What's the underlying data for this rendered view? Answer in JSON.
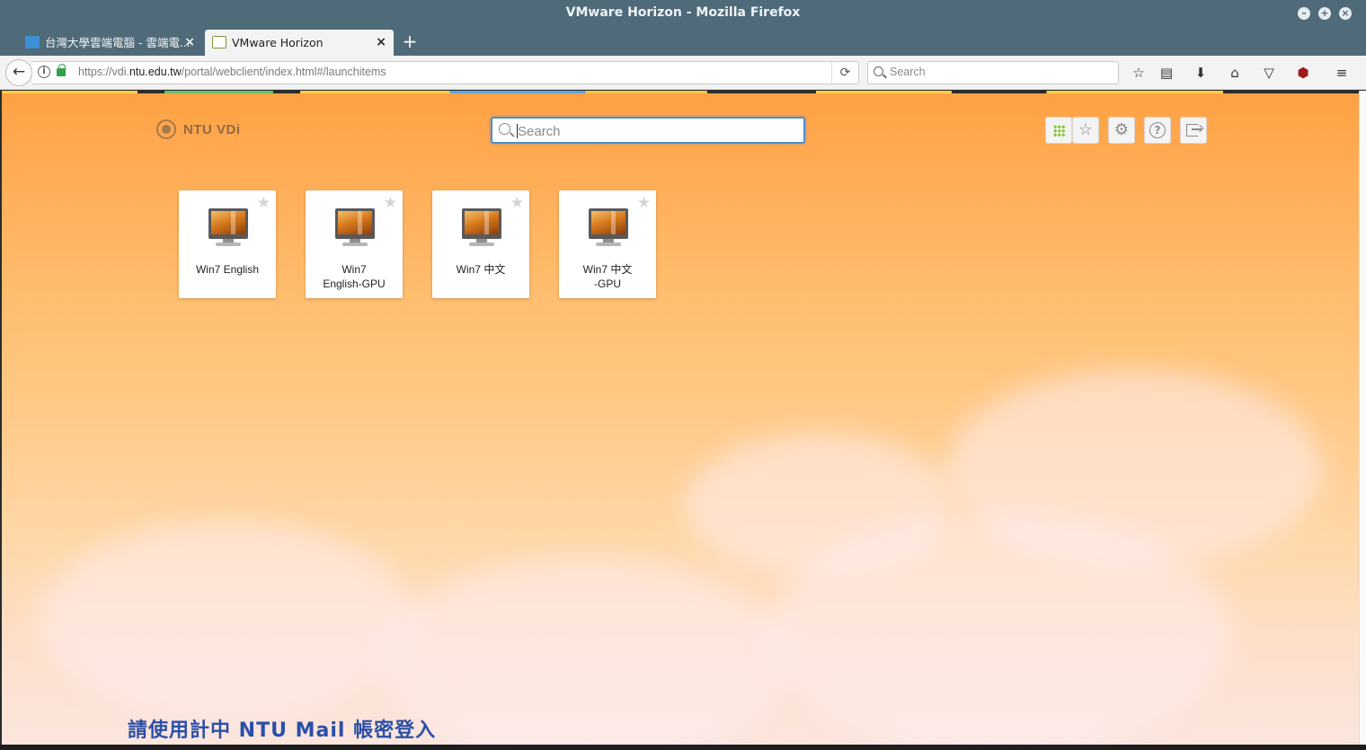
{
  "window": {
    "title": "VMware Horizon - Mozilla Firefox",
    "controls": [
      "minimize",
      "maximize",
      "close"
    ]
  },
  "tabs": [
    {
      "label": "台灣大學雲端電腦 - 雲端電...",
      "active": false,
      "favicon": "cloud-icon"
    },
    {
      "label": "VMware Horizon",
      "active": true,
      "favicon": "horizon-icon"
    }
  ],
  "navbar": {
    "url_prefix": "https://vdi.",
    "url_host": "ntu.edu.tw",
    "url_path": "/portal/webclient/index.html#/launchitems",
    "search_placeholder": "Search",
    "toolbar_icons": [
      "bookmark-star-icon",
      "reading-list-icon",
      "downloads-icon",
      "home-icon",
      "pocket-icon",
      "ublock-icon",
      "menu-icon"
    ]
  },
  "portal": {
    "logo_text": "NTU VDi",
    "search_placeholder": "Search",
    "toolbar_buttons": [
      "all-apps-grid-icon",
      "favorites-star-icon",
      "settings-gear-icon",
      "help-icon",
      "logout-icon"
    ],
    "items": [
      {
        "name": "Win7 English",
        "favorite": false
      },
      {
        "name": "Win7\nEnglish-GPU",
        "favorite": false
      },
      {
        "name": "Win7 中文",
        "favorite": false
      },
      {
        "name": "Win7 中文\n-GPU",
        "favorite": false
      }
    ],
    "login_message": "請使用計中 NTU Mail 帳密登入"
  },
  "colors": {
    "title_bar": "#4f6a78",
    "accent_green": "#8cc43f",
    "search_focus": "#4c8fd2",
    "message_blue": "#2a4fa8"
  }
}
